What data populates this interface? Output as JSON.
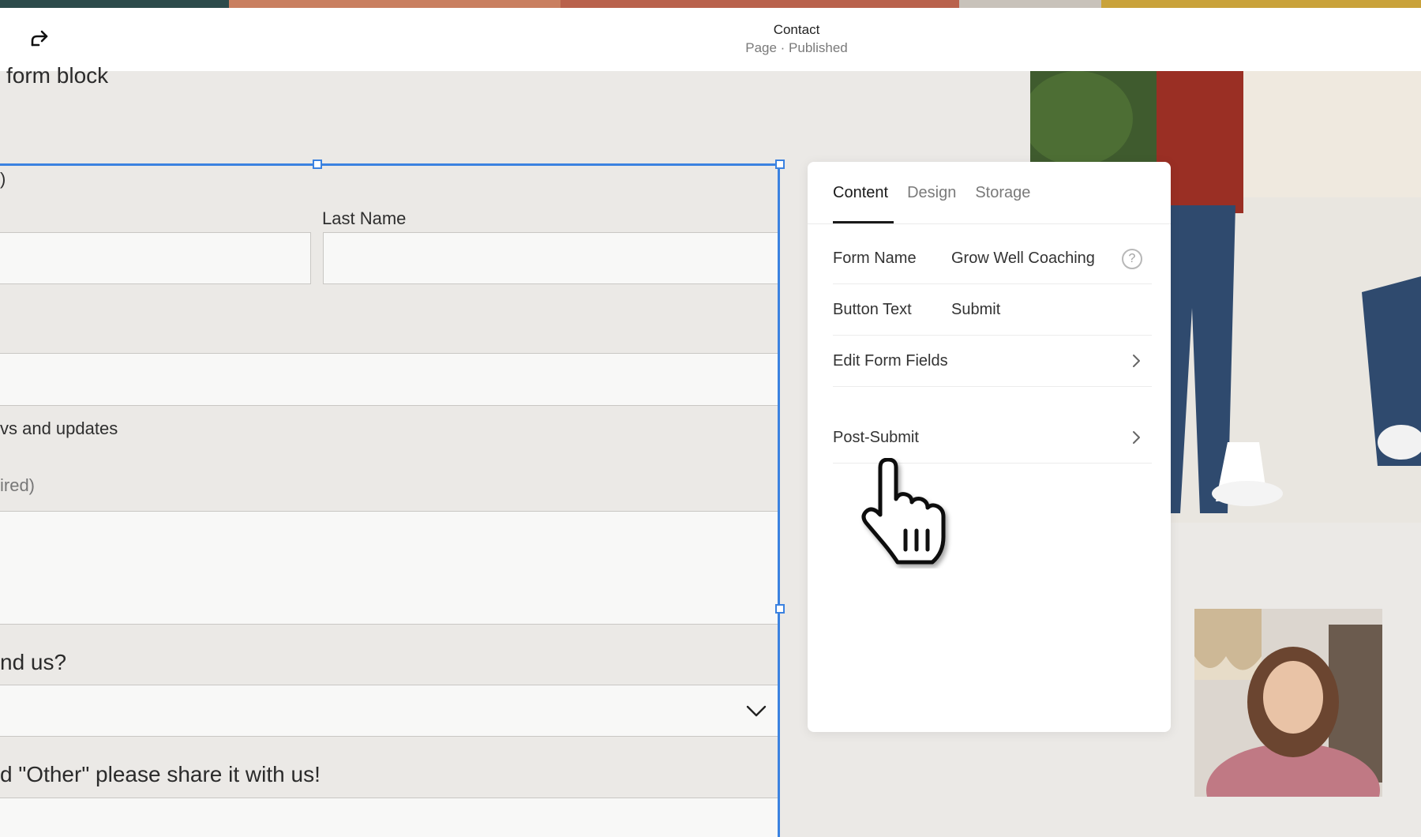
{
  "header": {
    "page_title": "Contact",
    "page_status": "Page · Published"
  },
  "colors": {
    "selection": "#3b82e0",
    "stripe": [
      "#2c4a4a",
      "#c97f60",
      "#b9624c",
      "#c8c2ba",
      "#c9a23a"
    ]
  },
  "form_preview": {
    "block_title": "form block",
    "name_paren": ")",
    "last_name_label": "Last Name",
    "newsletter_label": "vs and updates",
    "required_hint": "ired)",
    "find_us_label": "nd us?",
    "other_label": "d \"Other\" please share it with us!"
  },
  "panel": {
    "tabs": [
      {
        "label": "Content",
        "active": true
      },
      {
        "label": "Design",
        "active": false
      },
      {
        "label": "Storage",
        "active": false
      }
    ],
    "rows": {
      "form_name_key": "Form Name",
      "form_name_value": "Grow Well Coaching",
      "button_text_key": "Button Text",
      "button_text_value": "Submit",
      "edit_fields": "Edit Form Fields",
      "post_submit": "Post-Submit"
    }
  },
  "icons": {
    "redo": "redo-arrow-icon",
    "help": "question-circle-icon",
    "chevron": "chevron-right-icon",
    "dropdown": "chevron-down-icon",
    "cursor": "hand-pointer-icon"
  }
}
